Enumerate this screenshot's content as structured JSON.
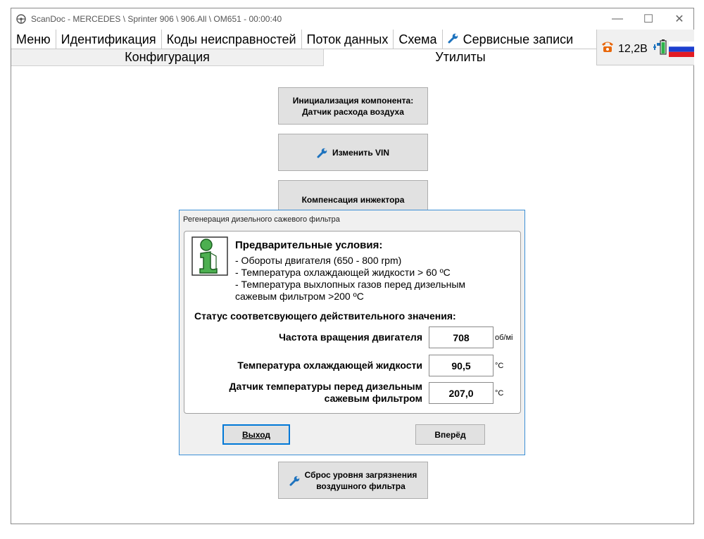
{
  "window": {
    "title": "ScanDoc - MERCEDES \\ Sprinter 906 \\ 906.All \\ OM651 - 00:00:40",
    "minimize": "—",
    "maximize": "☐",
    "close": "✕"
  },
  "menu": {
    "items": [
      "Меню",
      "Идентификация",
      "Коды неисправностей",
      "Поток данных",
      "Схема",
      "Сервисные записи"
    ]
  },
  "subtabs": [
    "Конфигурация",
    "Утилиты"
  ],
  "status": {
    "voltage": "12,2В"
  },
  "actions": {
    "init_component": [
      "Инициализация компонента:",
      "Датчик расхода воздуха"
    ],
    "change_vin": "Изменить VIN",
    "injector_comp": "Компенсация инжектора",
    "air_filter_reset": [
      "Сброс уровня загрязнения",
      "воздушного фильтра"
    ]
  },
  "dialog": {
    "title": "Регенерация дизельного сажевого фильтра",
    "preconditions_title": "Предварительные условия:",
    "preconditions": [
      "- Обороты двигателя (650 - 800 rpm)",
      "- Температура охлаждающей жидкости > 60 ºC",
      "- Температура выхлопных газов перед дизельным",
      "сажевым фильтром >200 ºC"
    ],
    "status_title": "Статус соответсвующего действительного значения:",
    "params": [
      {
        "label": "Частота вращения двигателя",
        "value": "708",
        "unit": "об/мі"
      },
      {
        "label": "Температура охлаждающей жидкости",
        "value": "90,5",
        "unit": "°C"
      },
      {
        "label_lines": [
          "Датчик температуры перед дизельным",
          "сажевым фильтром"
        ],
        "value": "207,0",
        "unit": "°C"
      }
    ],
    "exit_button": "Выход",
    "next_button": "Вперёд"
  },
  "colors": {
    "dialog_border": "#3c8fd6",
    "button_face": "#e1e1e1",
    "panel_bg": "#f0f0f0",
    "phone_icon": "#e8680c"
  }
}
